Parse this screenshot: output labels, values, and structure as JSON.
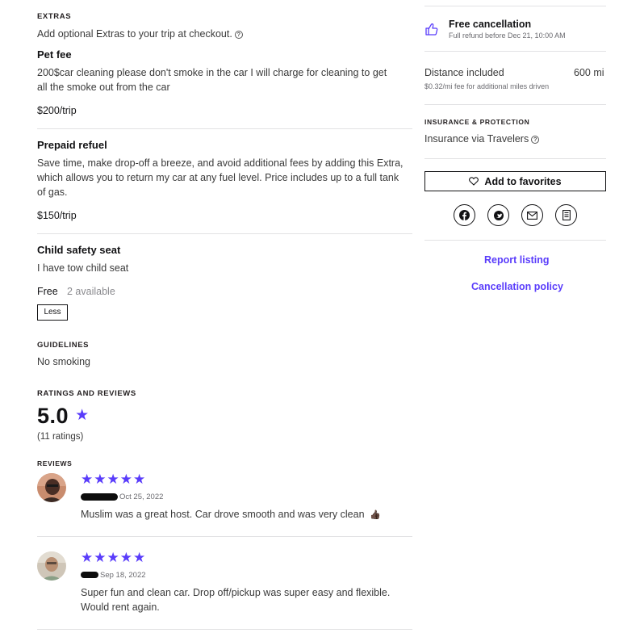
{
  "extras": {
    "heading": "EXTRAS",
    "intro": "Add optional Extras to your trip at checkout.",
    "items": [
      {
        "title": "Pet fee",
        "description_line1": "200$car cleaning please don't smoke in the car I will charge for cleaning to get",
        "description_line2": "all the smoke out from the car",
        "price": "$200/trip"
      },
      {
        "title": "Prepaid refuel",
        "description_line1": "Save time, make drop-off a breeze, and avoid additional fees by adding this Extra,",
        "description_line2": "which allows you to return my car at any fuel level. Price includes up to a full tank",
        "description_line3": "of gas.",
        "price": "$150/trip"
      },
      {
        "title": "Child safety seat",
        "description_line1": "I have tow child seat",
        "price": "Free",
        "availability": "2 available"
      }
    ],
    "less_label": "Less"
  },
  "guidelines": {
    "heading": "GUIDELINES",
    "text": "No smoking"
  },
  "ratings": {
    "heading": "RATINGS AND REVIEWS",
    "score": "5.0",
    "count": "(11 ratings)",
    "star_rating": 5
  },
  "reviews": {
    "heading": "REVIEWS",
    "items": [
      {
        "date": "Oct 25, 2022",
        "text": "Muslim was a great host. Car drove smooth and was very clean",
        "emoji": "👍🏿",
        "stars": "★★★★★"
      },
      {
        "date": "Sep 18, 2022",
        "text_line1": "Super fun and clean car. Drop off/pickup was super easy and flexible.",
        "text_line2": "Would rent again.",
        "stars": "★★★★★"
      }
    ]
  },
  "sidebar": {
    "cancellation": {
      "title": "Free cancellation",
      "subtitle": "Full refund before Dec 21, 10:00 AM"
    },
    "distance": {
      "label": "Distance included",
      "value": "600 mi",
      "fee": "$0.32/mi fee for additional miles driven"
    },
    "insurance": {
      "heading": "INSURANCE & PROTECTION",
      "text": "Insurance via Travelers"
    },
    "favorites_label": "Add to favorites",
    "share_icons": [
      "facebook-icon",
      "twitter-icon",
      "email-icon",
      "copy-link-icon"
    ],
    "report_label": "Report listing",
    "cancellation_policy_label": "Cancellation policy"
  },
  "colors": {
    "accent": "#593cfb",
    "text": "#231f20",
    "divider": "#e2e2e4"
  }
}
